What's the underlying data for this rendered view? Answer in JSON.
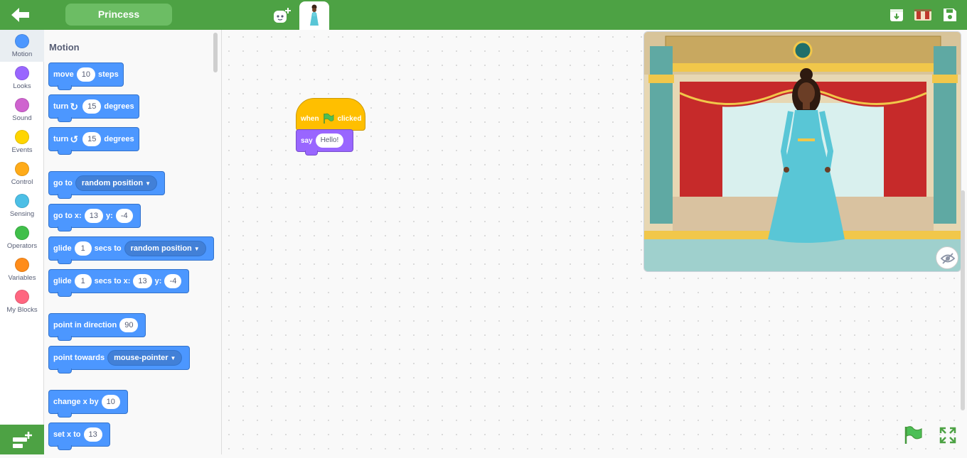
{
  "topbar": {
    "project_name": "Princess"
  },
  "categories": [
    {
      "label": "Motion",
      "color": "#4c97ff",
      "active": true
    },
    {
      "label": "Looks",
      "color": "#9966ff"
    },
    {
      "label": "Sound",
      "color": "#cf63cf"
    },
    {
      "label": "Events",
      "color": "#ffd500"
    },
    {
      "label": "Control",
      "color": "#ffab19"
    },
    {
      "label": "Sensing",
      "color": "#4cbfe6"
    },
    {
      "label": "Operators",
      "color": "#40bf4a"
    },
    {
      "label": "Variables",
      "color": "#ff8c1a"
    },
    {
      "label": "My Blocks",
      "color": "#ff6680"
    }
  ],
  "palette": {
    "title": "Motion",
    "move": {
      "label": "move",
      "value": "10",
      "suffix": "steps"
    },
    "turn_right": {
      "label": "turn",
      "value": "15",
      "suffix": "degrees"
    },
    "turn_left": {
      "label": "turn",
      "value": "15",
      "suffix": "degrees"
    },
    "go_to": {
      "label": "go to",
      "option": "random position"
    },
    "go_to_xy": {
      "label": "go to x:",
      "x": "13",
      "y_label": "y:",
      "y": "-4"
    },
    "glide_to": {
      "label": "glide",
      "secs": "1",
      "mid": "secs to",
      "option": "random position"
    },
    "glide_xy": {
      "label": "glide",
      "secs": "1",
      "mid": "secs to x:",
      "x": "13",
      "y_label": "y:",
      "y": "-4"
    },
    "point_dir": {
      "label": "point in direction",
      "value": "90"
    },
    "point_towards": {
      "label": "point towards",
      "option": "mouse-pointer"
    },
    "change_x": {
      "label": "change x by",
      "value": "10"
    },
    "set_x": {
      "label": "set x to",
      "value": "13"
    }
  },
  "script": {
    "hat_when": "when",
    "hat_clicked": "clicked",
    "say_label": "say",
    "say_value": "Hello!"
  },
  "icons": [
    "back-arrow-icon",
    "add-sprite-icon",
    "sprite-thumbnail-princess",
    "download-icon",
    "stage-icon",
    "save-icon",
    "add-extension-icon",
    "hide-stage-icon",
    "green-flag-icon",
    "fullscreen-icon"
  ]
}
